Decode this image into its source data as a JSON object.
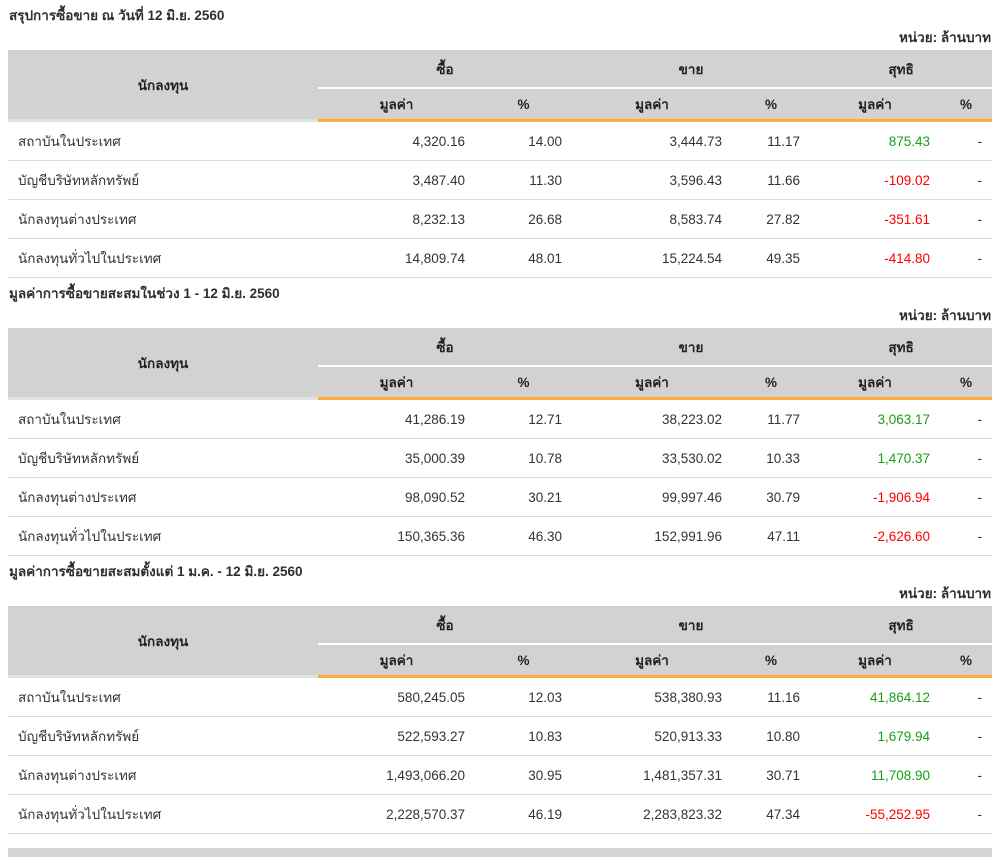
{
  "page": {
    "unit_label": "หน่วย: ล้านบาท"
  },
  "columns": {
    "investor": "นักลงทุน",
    "buy": "ซื้อ",
    "sell": "ขาย",
    "net": "สุทธิ",
    "value": "มูลค่า",
    "percent": "%"
  },
  "colors": {
    "header_bg": "#d2d2d2",
    "accent_orange": "#fbac3c",
    "positive_green": "#17a017",
    "negative_red": "#ff0000"
  },
  "tables": [
    {
      "title": "สรุปการซื้อขาย ณ วันที่ 12 มิ.ย. 2560",
      "rows": [
        {
          "investor": "สถาบันในประเทศ",
          "buy_value": "4,320.16",
          "buy_pct": "14.00",
          "sell_value": "3,444.73",
          "sell_pct": "11.17",
          "net_value": "875.43",
          "net_pct": "-"
        },
        {
          "investor": "บัญชีบริษัทหลักทรัพย์",
          "buy_value": "3,487.40",
          "buy_pct": "11.30",
          "sell_value": "3,596.43",
          "sell_pct": "11.66",
          "net_value": "-109.02",
          "net_pct": "-"
        },
        {
          "investor": "นักลงทุนต่างประเทศ",
          "buy_value": "8,232.13",
          "buy_pct": "26.68",
          "sell_value": "8,583.74",
          "sell_pct": "27.82",
          "net_value": "-351.61",
          "net_pct": "-"
        },
        {
          "investor": "นักลงทุนทั่วไปในประเทศ",
          "buy_value": "14,809.74",
          "buy_pct": "48.01",
          "sell_value": "15,224.54",
          "sell_pct": "49.35",
          "net_value": "-414.80",
          "net_pct": "-"
        }
      ]
    },
    {
      "title": "มูลค่าการซื้อขายสะสมในช่วง 1 - 12 มิ.ย. 2560",
      "rows": [
        {
          "investor": "สถาบันในประเทศ",
          "buy_value": "41,286.19",
          "buy_pct": "12.71",
          "sell_value": "38,223.02",
          "sell_pct": "11.77",
          "net_value": "3,063.17",
          "net_pct": "-"
        },
        {
          "investor": "บัญชีบริษัทหลักทรัพย์",
          "buy_value": "35,000.39",
          "buy_pct": "10.78",
          "sell_value": "33,530.02",
          "sell_pct": "10.33",
          "net_value": "1,470.37",
          "net_pct": "-"
        },
        {
          "investor": "นักลงทุนต่างประเทศ",
          "buy_value": "98,090.52",
          "buy_pct": "30.21",
          "sell_value": "99,997.46",
          "sell_pct": "30.79",
          "net_value": "-1,906.94",
          "net_pct": "-"
        },
        {
          "investor": "นักลงทุนทั่วไปในประเทศ",
          "buy_value": "150,365.36",
          "buy_pct": "46.30",
          "sell_value": "152,991.96",
          "sell_pct": "47.11",
          "net_value": "-2,626.60",
          "net_pct": "-"
        }
      ]
    },
    {
      "title": "มูลค่าการซื้อขายสะสมตั้งแต่ 1 ม.ค. - 12 มิ.ย. 2560",
      "rows": [
        {
          "investor": "สถาบันในประเทศ",
          "buy_value": "580,245.05",
          "buy_pct": "12.03",
          "sell_value": "538,380.93",
          "sell_pct": "11.16",
          "net_value": "41,864.12",
          "net_pct": "-"
        },
        {
          "investor": "บัญชีบริษัทหลักทรัพย์",
          "buy_value": "522,593.27",
          "buy_pct": "10.83",
          "sell_value": "520,913.33",
          "sell_pct": "10.80",
          "net_value": "1,679.94",
          "net_pct": "-"
        },
        {
          "investor": "นักลงทุนต่างประเทศ",
          "buy_value": "1,493,066.20",
          "buy_pct": "30.95",
          "sell_value": "1,481,357.31",
          "sell_pct": "30.71",
          "net_value": "11,708.90",
          "net_pct": "-"
        },
        {
          "investor": "นักลงทุนทั่วไปในประเทศ",
          "buy_value": "2,228,570.37",
          "buy_pct": "46.19",
          "sell_value": "2,283,823.32",
          "sell_pct": "47.34",
          "net_value": "-55,252.95",
          "net_pct": "-"
        }
      ]
    }
  ]
}
